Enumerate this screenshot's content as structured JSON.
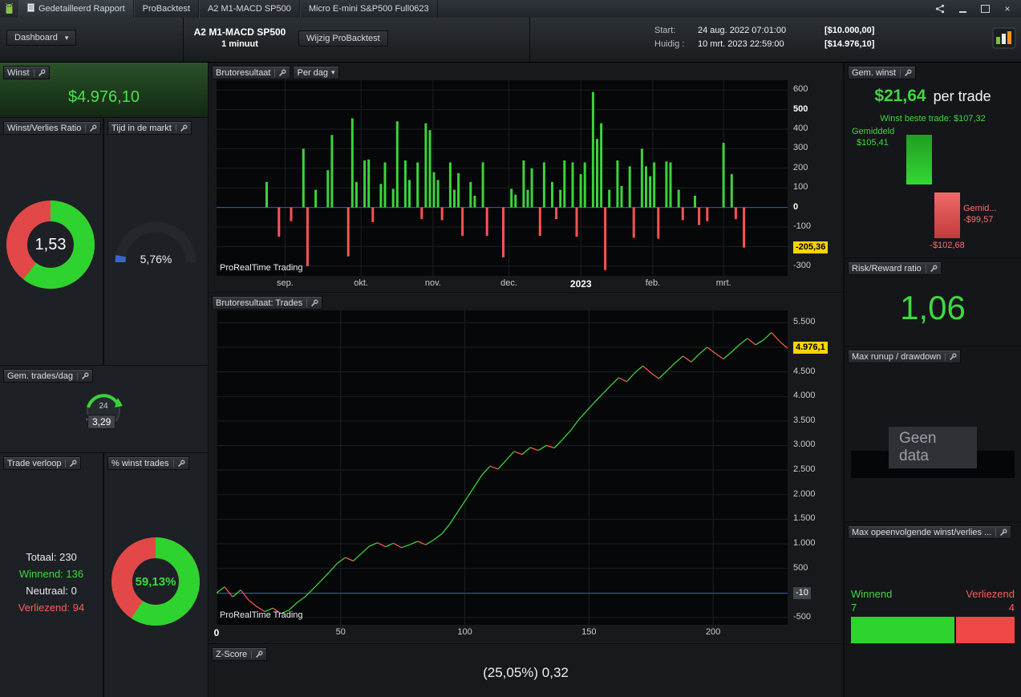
{
  "colors": {
    "green": "#3bd33b",
    "red": "#ff5252",
    "blue": "#3b57c8",
    "yellow": "#ffd400"
  },
  "window": {
    "tabs": [
      "Gedetailleerd Rapport",
      "ProBacktest",
      "A2 M1-MACD SP500",
      "Micro E-mini S&P500 Full0623"
    ]
  },
  "toolbar": {
    "dashboard_label": "Dashboard",
    "title_line1": "A2 M1-MACD SP500",
    "title_line2": "1 minuut",
    "edit_button": "Wijzig ProBacktest",
    "start_label": "Start:",
    "start_datetime": "24 aug. 2022 07:01:00",
    "start_amount": "[$10.000,00]",
    "current_label": "Huidig :",
    "current_datetime": "10 mrt. 2023 22:59:00",
    "current_amount": "[$14.976,10]"
  },
  "left": {
    "winst": {
      "label": "Winst",
      "value": "$4.976,10"
    },
    "ratio": {
      "label": "Winst/Verlies Ratio",
      "value": "1,53",
      "green_fraction": 0.605
    },
    "tijd": {
      "label": "Tijd in de markt",
      "value": "5,76%",
      "fraction": 0.0576
    },
    "trades_per_dag": {
      "label": "Gem. trades/dag",
      "value": "3,29",
      "icon_text": "24"
    },
    "verloop": {
      "label": "Trade verloop",
      "totaal": "Totaal: 230",
      "winnend": "Winnend: 136",
      "neutraal": "Neutraal: 0",
      "verliezend": "Verliezend: 94"
    },
    "pct_winst": {
      "label": "% winst trades",
      "value": "59,13%",
      "fraction": 0.5913
    }
  },
  "center": {
    "bar_panel": {
      "label": "Brutoresultaat",
      "dropdown": "Per dag"
    },
    "eq_panel": {
      "label": "Brutoresultaat: Trades"
    },
    "zscore": {
      "label": "Z-Score",
      "value": "(25,05%) 0,32"
    }
  },
  "right": {
    "gem_winst": {
      "label": "Gem. winst",
      "value": "$21,64",
      "suffix": "per trade",
      "best": "Winst beste trade: $107,32",
      "avg_win_label": "Gemiddeld",
      "avg_win": "$105,41",
      "avg_loss_label": "Gemid...",
      "avg_loss": "-$99,57",
      "worst": "-$102,68"
    },
    "risk_reward": {
      "label": "Risk/Reward ratio",
      "value": "1,06"
    },
    "runup": {
      "label": "Max runup / drawdown",
      "empty": "Geen data"
    },
    "streak": {
      "label": "Max opeenvolgende winst/verlies ...",
      "win_label": "Winnend",
      "win_value": "7",
      "loss_label": "Verliezend",
      "loss_value": "4",
      "wins": 7,
      "losses": 4
    }
  },
  "watermark": "ProRealTime Trading",
  "chart_data": [
    {
      "type": "bar",
      "title": "Brutoresultaat Per dag",
      "ylim": [
        -350,
        650
      ],
      "gridlines": [
        600,
        500,
        400,
        300,
        200,
        100,
        0,
        -100,
        -200,
        -300
      ],
      "ylabels": [
        {
          "v": 600,
          "t": "600"
        },
        {
          "v": 500,
          "t": "500",
          "bold": true
        },
        {
          "v": 400,
          "t": "400"
        },
        {
          "v": 300,
          "t": "300"
        },
        {
          "v": 200,
          "t": "200"
        },
        {
          "v": 100,
          "t": "100"
        },
        {
          "v": 0,
          "t": "0",
          "bold": true
        },
        {
          "v": -100,
          "t": "-100"
        },
        {
          "v": -205.36,
          "t": "-205,36",
          "badge": "yellow"
        },
        {
          "v": -300,
          "t": "-300"
        }
      ],
      "xticks": [
        {
          "f": 0.12,
          "t": "sep."
        },
        {
          "f": 0.253,
          "t": "okt."
        },
        {
          "f": 0.379,
          "t": "nov."
        },
        {
          "f": 0.512,
          "t": "dec."
        },
        {
          "f": 0.638,
          "t": "2023",
          "bold": true
        },
        {
          "f": 0.764,
          "t": "feb."
        },
        {
          "f": 0.888,
          "t": "mrt."
        }
      ],
      "zero_line": 0,
      "values": [
        0,
        0,
        0,
        0,
        0,
        0,
        0,
        0,
        0,
        0,
        0,
        0,
        130,
        0,
        0,
        -150,
        0,
        0,
        -70,
        0,
        0,
        300,
        -300,
        0,
        90,
        0,
        0,
        190,
        370,
        0,
        0,
        0,
        -250,
        455,
        130,
        0,
        240,
        245,
        -75,
        0,
        120,
        230,
        0,
        95,
        440,
        0,
        240,
        140,
        0,
        230,
        -60,
        430,
        395,
        180,
        140,
        -65,
        0,
        230,
        90,
        175,
        -145,
        0,
        130,
        60,
        0,
        230,
        -145,
        0,
        0,
        0,
        -255,
        0,
        95,
        65,
        0,
        240,
        90,
        200,
        0,
        -145,
        230,
        0,
        130,
        -60,
        90,
        240,
        0,
        230,
        -150,
        170,
        230,
        0,
        590,
        350,
        430,
        -320,
        90,
        0,
        240,
        110,
        0,
        210,
        -155,
        0,
        300,
        210,
        160,
        230,
        -160,
        0,
        235,
        230,
        0,
        90,
        -65,
        0,
        0,
        60,
        -90,
        0,
        -70,
        0,
        0,
        0,
        330,
        0,
        170,
        -60,
        0,
        -205.36,
        0,
        0,
        0,
        0,
        0,
        0,
        0,
        0,
        0,
        0
      ]
    },
    {
      "type": "line",
      "title": "Brutoresultaat: Trades",
      "xmax": 230,
      "ylim": [
        -650,
        5750
      ],
      "hgrid": [
        5500,
        5000,
        4500,
        4000,
        3500,
        3000,
        2500,
        2000,
        1500,
        1000,
        500,
        0,
        -500
      ],
      "ylabels": [
        {
          "v": 5500,
          "t": "5.500"
        },
        {
          "v": 4976.1,
          "t": "4.976,1",
          "badge": "yellow"
        },
        {
          "v": 4500,
          "t": "4.500"
        },
        {
          "v": 4000,
          "t": "4.000"
        },
        {
          "v": 3500,
          "t": "3.500"
        },
        {
          "v": 3000,
          "t": "3.000"
        },
        {
          "v": 2500,
          "t": "2.500"
        },
        {
          "v": 2000,
          "t": "2.000"
        },
        {
          "v": 1500,
          "t": "1.500"
        },
        {
          "v": 1000,
          "t": "1.000"
        },
        {
          "v": 500,
          "t": "500"
        },
        {
          "v": -10,
          "t": "-10",
          "badge": "gray"
        },
        {
          "v": -500,
          "t": "-500"
        }
      ],
      "xlabels": [
        {
          "v": 0,
          "t": "0",
          "bold": true
        },
        {
          "v": 50,
          "t": "50"
        },
        {
          "v": 100,
          "t": "100"
        },
        {
          "v": 150,
          "t": "150"
        },
        {
          "v": 200,
          "t": "200"
        }
      ],
      "blue_line": -10,
      "values": [
        0,
        120,
        -80,
        60,
        -150,
        -280,
        -380,
        -310,
        -420,
        -350,
        -200,
        -80,
        80,
        250,
        420,
        600,
        720,
        650,
        800,
        950,
        1020,
        940,
        1010,
        920,
        980,
        1050,
        980,
        1080,
        1200,
        1400,
        1650,
        1900,
        2150,
        2400,
        2580,
        2520,
        2700,
        2880,
        2820,
        2960,
        2900,
        3000,
        2950,
        3120,
        3300,
        3520,
        3700,
        3880,
        4050,
        4220,
        4380,
        4300,
        4480,
        4620,
        4480,
        4360,
        4520,
        4680,
        4820,
        4700,
        4860,
        5000,
        4880,
        4760,
        4900,
        5050,
        5180,
        5050,
        5150,
        5300,
        5120,
        4976.1
      ]
    }
  ]
}
